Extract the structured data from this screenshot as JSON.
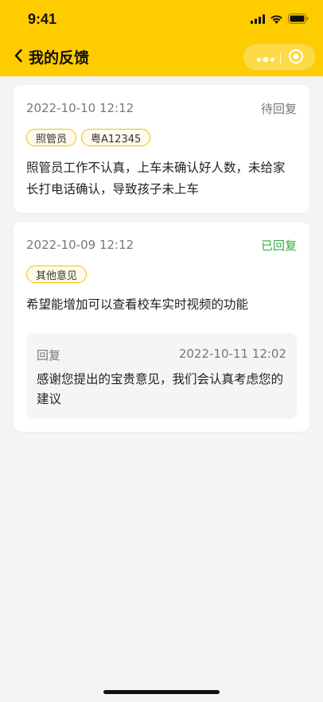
{
  "status_bar": {
    "time": "9:41"
  },
  "nav": {
    "title": "我的反馈"
  },
  "colors": {
    "brand": "#ffcc00",
    "pending": "#777777",
    "replied": "#3aa84a",
    "tag_border": "#f2c200"
  },
  "feedbacks": [
    {
      "date": "2022-10-10 12:12",
      "status": "待回复",
      "status_type": "pending",
      "tags": [
        "照管员",
        "粤A12345"
      ],
      "content": "照管员工作不认真，上车未确认好人数，未给家长打电话确认，导致孩子未上车"
    },
    {
      "date": "2022-10-09 12:12",
      "status": "已回复",
      "status_type": "replied",
      "tags": [
        "其他意见"
      ],
      "content": "希望能增加可以查看校车实时视频的功能",
      "reply": {
        "label": "回复",
        "time": "2022-10-11 12:02",
        "content": "感谢您提出的宝贵意见，我们会认真考虑您的建议"
      }
    }
  ]
}
